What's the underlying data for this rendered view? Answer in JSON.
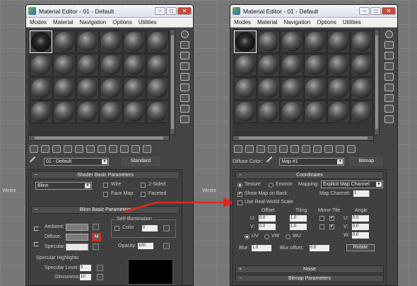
{
  "left_window": {
    "title": "Material Editor - 01 - Default",
    "menu": [
      "Modes",
      "Material",
      "Navigation",
      "Options",
      "Utilities"
    ],
    "material_name": "01 - Default",
    "material_type": "Standard",
    "shader": {
      "header": "Shader Basic Parameters",
      "shader_type": "Blinn",
      "wire": "Wire",
      "two_sided": "2-Sided",
      "face_map": "Face Map",
      "faceted": "Faceted"
    },
    "blinn": {
      "header": "Blinn Basic Parameters",
      "self_illum_title": "Self-Illumination",
      "color_label": "Color",
      "color_value": "0",
      "ambient": "Ambient:",
      "diffuse": "Diffuse:",
      "specular": "Specular:",
      "map_button": "M",
      "opacity_label": "Opacity:",
      "opacity_value": "100",
      "highlights_title": "Specular Highlights",
      "spec_level_label": "Specular Level:",
      "spec_level_value": "0",
      "glossiness_label": "Glossiness:",
      "glossiness_value": "10"
    }
  },
  "right_window": {
    "title": "Material Editor - 01 - Default",
    "menu": [
      "Modes",
      "Material",
      "Navigation",
      "Options",
      "Utilities"
    ],
    "slot_label": "Diffuse Color:",
    "map_name": "Map #1",
    "map_type": "Bitmap",
    "coords": {
      "header": "Coordinates",
      "texture": "Texture",
      "environ": "Environ",
      "mapping_label": "Mapping:",
      "mapping_value": "Explicit Map Channel",
      "show_map_on_back": "Show Map on Back",
      "map_channel_label": "Map Channel:",
      "map_channel_value": "1",
      "real_world": "Use Real-World Scale",
      "offset": "Offset",
      "tiling": "Tiling",
      "mirror_tile": "Mirror Tile",
      "angle": "Angle",
      "u_label": "U:",
      "v_label": "V:",
      "w_label": "W:",
      "u_offset": "0.0",
      "v_offset": "0.0",
      "u_tiling": "1.0",
      "v_tiling": "1.0",
      "u_angle": "0.0",
      "v_angle": "0.0",
      "w_angle": "0.0",
      "uv": "UV",
      "vw": "VW",
      "wu": "WU",
      "blur_label": "Blur:",
      "blur_value": "1.0",
      "blur_offset_label": "Blur offset:",
      "blur_offset_value": "0.0",
      "rotate": "Rotate"
    },
    "noise_header": "Noise",
    "bitmap_header": "Bitmap Parameters"
  },
  "viewport_label": "Vertex",
  "colors": {
    "highlight": "#e0281e",
    "panel": "#404040",
    "window": "#444444"
  }
}
